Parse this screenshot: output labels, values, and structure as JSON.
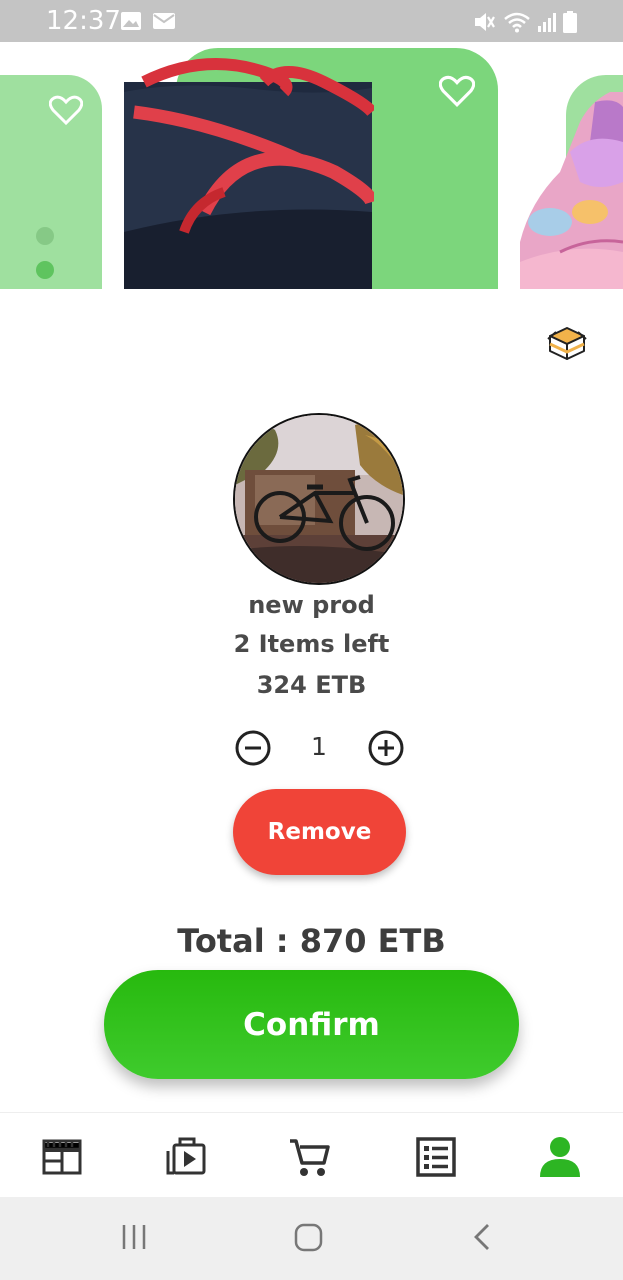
{
  "status_bar": {
    "time": "12:37",
    "left_icons": [
      "image-icon",
      "mail-icon"
    ],
    "right_icons": [
      "mute-icon",
      "wifi-icon",
      "signal-icon",
      "battery-icon"
    ]
  },
  "carousel": {
    "items": [
      {
        "image": "previous-product-image",
        "favorite_icon": "heart-outline-icon"
      },
      {
        "image": "sandal-image",
        "favorite_icon": "heart-outline-icon"
      },
      {
        "image": "pink-shoe-image"
      }
    ],
    "indicator_dots": 2
  },
  "cart_item": {
    "name": "new prod",
    "stock": "2 Items left",
    "price": "324 ETB",
    "quantity": "1",
    "remove_label": "Remove"
  },
  "total_label": "Total : 870 ETB",
  "confirm_label": "Confirm",
  "bottom_nav": {
    "items": [
      {
        "icon": "store-icon",
        "active": false
      },
      {
        "icon": "video-library-icon",
        "active": false
      },
      {
        "icon": "cart-icon",
        "active": false
      },
      {
        "icon": "list-icon",
        "active": false
      },
      {
        "icon": "profile-icon",
        "active": true
      }
    ]
  },
  "colors": {
    "accent_green": "#2db523",
    "remove_red": "#f04438",
    "card_green": "#7cd67c"
  }
}
